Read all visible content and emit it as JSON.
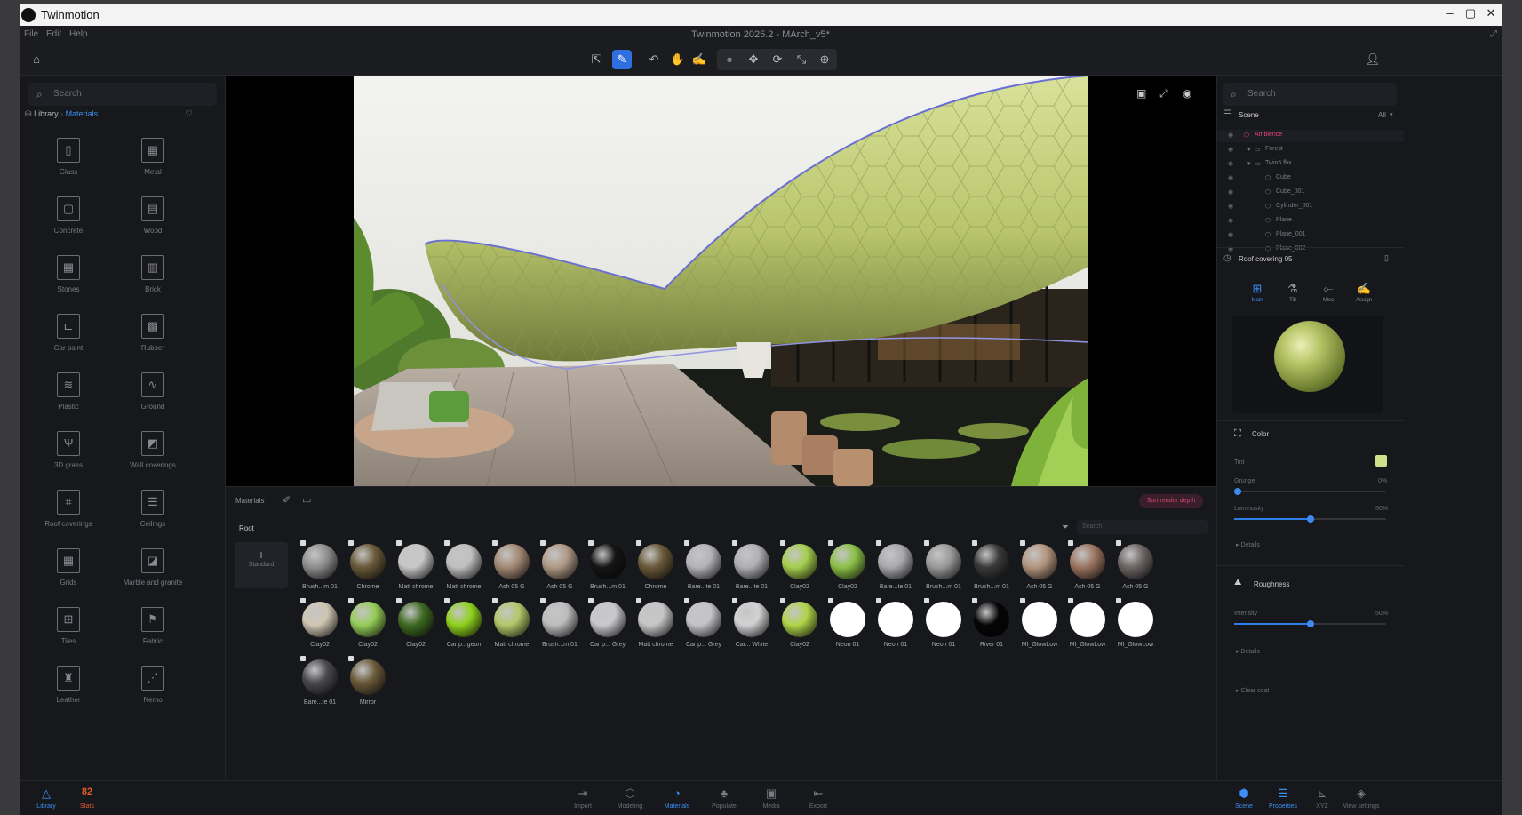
{
  "os_window": {
    "app_name": "Twinmotion",
    "controls": [
      "–",
      "▢",
      "✕"
    ]
  },
  "menubar": {
    "items": [
      "File",
      "Edit",
      "Help"
    ],
    "title": "Twinmotion 2025.2 - MArch_v5*"
  },
  "left_panel": {
    "search_placeholder": "Search",
    "breadcrumb_root": "Library",
    "breadcrumb_current": "Materials",
    "categories": [
      {
        "label": "Glass",
        "icon": "glass-icon"
      },
      {
        "label": "Metal",
        "icon": "metal-icon"
      },
      {
        "label": "Concrete",
        "icon": "concrete-icon"
      },
      {
        "label": "Wood",
        "icon": "wood-icon"
      },
      {
        "label": "Stones",
        "icon": "stones-icon"
      },
      {
        "label": "Brick",
        "icon": "brick-icon"
      },
      {
        "label": "Car paint",
        "icon": "car-paint-icon"
      },
      {
        "label": "Rubber",
        "icon": "rubber-icon"
      },
      {
        "label": "Plastic",
        "icon": "plastic-icon"
      },
      {
        "label": "Ground",
        "icon": "ground-icon"
      },
      {
        "label": "3D grass",
        "icon": "grass-icon"
      },
      {
        "label": "Wall coverings",
        "icon": "wall-coverings-icon"
      },
      {
        "label": "Roof coverings",
        "icon": "roof-coverings-icon"
      },
      {
        "label": "Ceilings",
        "icon": "ceilings-icon"
      },
      {
        "label": "Grids",
        "icon": "grids-icon"
      },
      {
        "label": "Marble and granite",
        "icon": "marble-icon"
      },
      {
        "label": "Tiles",
        "icon": "tiles-icon"
      },
      {
        "label": "Fabric",
        "icon": "fabric-icon"
      },
      {
        "label": "Leather",
        "icon": "leather-icon"
      },
      {
        "label": "Nemo",
        "icon": "nemo-icon"
      }
    ]
  },
  "materials_panel": {
    "title": "Materials",
    "root_label": "Root",
    "search_placeholder": "Search",
    "add_label": "Standard",
    "pill_label": "Sort render depth",
    "rows": [
      [
        {
          "label": "Brush...m 01",
          "color": "#8f8f8f"
        },
        {
          "label": "Chrome",
          "color": "#6b5a3a"
        },
        {
          "label": "Matt chrome",
          "color": "#c7c7c7"
        },
        {
          "label": "Matt chrome",
          "color": "#bfbfbf"
        },
        {
          "label": "Ash 05 G",
          "color": "#a58a75"
        },
        {
          "label": "Ash 05 G",
          "color": "#b09a86"
        },
        {
          "label": "Brush...m 01",
          "color": "#151515"
        },
        {
          "label": "Chrome",
          "color": "#6b5a3a"
        },
        {
          "label": "Bare...te 01",
          "color": "#b4b4b8"
        },
        {
          "label": "Bare...te 01",
          "color": "#b0b0b4"
        },
        {
          "label": "Clay02",
          "color": "#a6cf4d"
        },
        {
          "label": "Clay02",
          "color": "#8cc148"
        },
        {
          "label": "Bare...te 01",
          "color": "#a9a9ad"
        },
        {
          "label": "Brush...m 01",
          "color": "#9a9a9a"
        },
        {
          "label": "Brush...m 01",
          "color": "#3a3a3a"
        },
        {
          "label": "Ash 05 G",
          "color": "#b4957f"
        },
        {
          "label": "Ash 05 G",
          "color": "#9c7560"
        },
        {
          "label": "Ash 05 G",
          "color": "#6f6565"
        }
      ],
      [
        {
          "label": "Clay02",
          "color": "#cfc6b2"
        },
        {
          "label": "Clay02",
          "color": "#95cd58"
        },
        {
          "label": "Clay02",
          "color": "#3f6b22"
        },
        {
          "label": "Car p...geon",
          "color": "#8fd21e"
        },
        {
          "label": "Matt chrome",
          "color": "#b5c76a"
        },
        {
          "label": "Brush...m 01",
          "color": "#bdbdbd"
        },
        {
          "label": "Car p... Grey",
          "color": "#c9c9cc"
        },
        {
          "label": "Matt chrome",
          "color": "#c6c6c6"
        },
        {
          "label": "Car p... Grey",
          "color": "#c4c4c8"
        },
        {
          "label": "Car... White",
          "color": "#d2d2d4"
        },
        {
          "label": "Clay02",
          "color": "#b0d54a"
        },
        {
          "label": "Neon 01",
          "color": "#ffffff"
        },
        {
          "label": "Neon 01",
          "color": "#ffffff"
        },
        {
          "label": "Neon 01",
          "color": "#ffffff"
        },
        {
          "label": "River 01",
          "color": "#050505"
        },
        {
          "label": "MI_GlowLow",
          "color": "#ffffff"
        },
        {
          "label": "MI_GlowLow",
          "color": "#ffffff"
        },
        {
          "label": "MI_GlowLow",
          "color": "#ffffff"
        }
      ],
      [
        {
          "label": "Bare...te 01",
          "color": "#4a4a4e"
        },
        {
          "label": "Mirror",
          "color": "#6b5a3a"
        }
      ]
    ]
  },
  "right_panel": {
    "search_placeholder": "Search",
    "scene_label": "Scene",
    "scene_filter": "All",
    "tree": [
      {
        "label": "Ambience",
        "level": 0,
        "highlight": true
      },
      {
        "label": "Forest",
        "level": 1
      },
      {
        "label": "Twin5.fbx",
        "level": 1
      },
      {
        "label": "Cube",
        "level": 2
      },
      {
        "label": "Cube_001",
        "level": 2
      },
      {
        "label": "Cylinder_001",
        "level": 2
      },
      {
        "label": "Plane",
        "level": 2
      },
      {
        "label": "Plane_001",
        "level": 2
      },
      {
        "label": "Plane_002",
        "level": 2
      }
    ],
    "material_name": "Roof covering 05",
    "prop_tabs": [
      "Main",
      "Tilt",
      "Misc",
      "Assign"
    ],
    "color_section": "Color",
    "tint_label": "Tint",
    "tint_color": "#cfe08a",
    "grunge_label": "Grunge",
    "grunge_value": "0%",
    "grunge_level": 0.0,
    "luminosity_label": "Luminosity",
    "luminosity_value": "50%",
    "luminosity_level": 0.5,
    "details_label": "Details",
    "roughness_section": "Roughness",
    "intensity_label": "Intensity",
    "intensity_value": "50%",
    "intensity_level": 0.5,
    "clear_coat_label": "Clear coat"
  },
  "bottom_nav": {
    "left": [
      {
        "label": "Library",
        "icon": "library-icon",
        "active": true
      },
      {
        "label": "Stats",
        "icon": "stats-icon",
        "badge": "82"
      }
    ],
    "center": [
      {
        "label": "Import",
        "icon": "import-icon"
      },
      {
        "label": "Modeling",
        "icon": "modeling-icon"
      },
      {
        "label": "Materials",
        "icon": "materials-icon",
        "active": true
      },
      {
        "label": "Populate",
        "icon": "populate-icon"
      },
      {
        "label": "Media",
        "icon": "media-icon"
      },
      {
        "label": "Export",
        "icon": "export-icon"
      }
    ],
    "right": [
      {
        "label": "Scene",
        "icon": "scene-icon",
        "active": true
      },
      {
        "label": "Properties",
        "icon": "properties-icon",
        "active": true
      },
      {
        "label": "XYZ",
        "icon": "xyz-icon"
      },
      {
        "label": "View settings",
        "icon": "view-settings-icon"
      }
    ]
  },
  "colors": {
    "accent": "#2f7de8",
    "panel": "#17181c",
    "highlight": "#e0457b"
  }
}
